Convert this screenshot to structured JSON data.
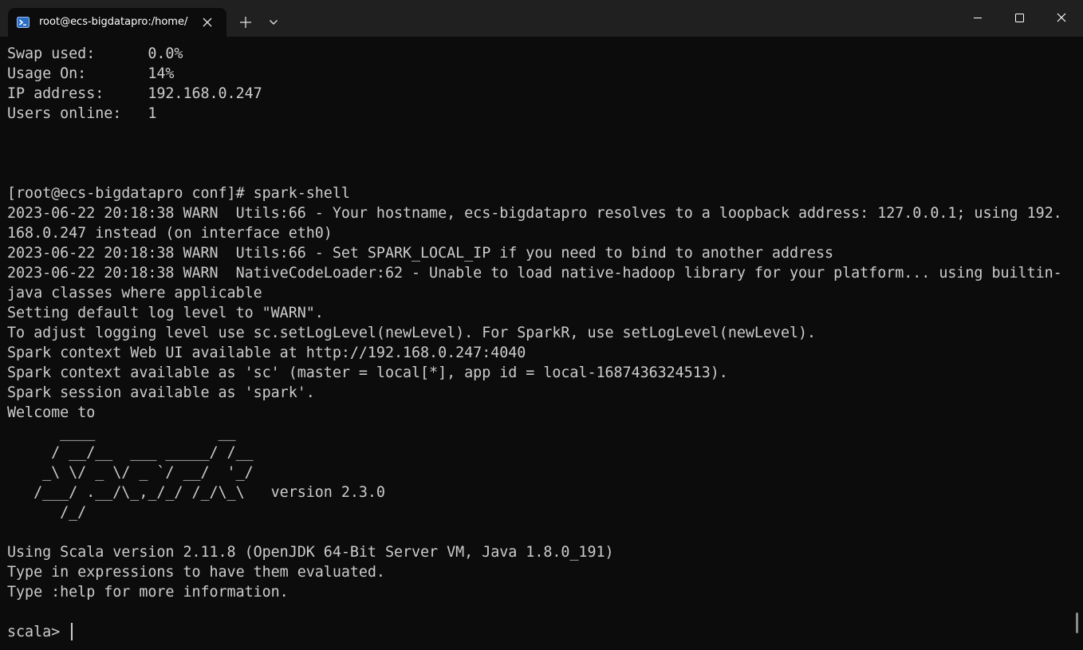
{
  "titlebar": {
    "tab_title": "root@ecs-bigdatapro:/home/",
    "tab_icon": "powershell-icon",
    "new_tab_icon": "plus-icon",
    "dropdown_icon": "chevron-down-icon",
    "minimize_icon": "minimize-icon",
    "maximize_icon": "maximize-icon",
    "close_icon": "close-icon"
  },
  "colors": {
    "titlebar_bg": "#202020",
    "terminal_bg": "#0c0c0c",
    "terminal_fg": "#cccccc",
    "tab_icon_accent": "#2b6cc4"
  },
  "terminal": {
    "lines": [
      "Swap used:      0.0%",
      "Usage On:       14%",
      "IP address:     192.168.0.247",
      "Users online:   1",
      "",
      "",
      "",
      "[root@ecs-bigdatapro conf]# spark-shell",
      "2023-06-22 20:18:38 WARN  Utils:66 - Your hostname, ecs-bigdatapro resolves to a loopback address: 127.0.0.1; using 192.",
      "168.0.247 instead (on interface eth0)",
      "2023-06-22 20:18:38 WARN  Utils:66 - Set SPARK_LOCAL_IP if you need to bind to another address",
      "2023-06-22 20:18:38 WARN  NativeCodeLoader:62 - Unable to load native-hadoop library for your platform... using builtin-",
      "java classes where applicable",
      "Setting default log level to \"WARN\".",
      "To adjust logging level use sc.setLogLevel(newLevel). For SparkR, use setLogLevel(newLevel).",
      "Spark context Web UI available at http://192.168.0.247:4040",
      "Spark context available as 'sc' (master = local[*], app id = local-1687436324513).",
      "Spark session available as 'spark'.",
      "Welcome to",
      "      ____              __",
      "     / __/__  ___ _____/ /__",
      "    _\\ \\/ _ \\/ _ `/ __/  '_/",
      "   /___/ .__/\\_,_/_/ /_/\\_\\   version 2.3.0",
      "      /_/",
      "",
      "Using Scala version 2.11.8 (OpenJDK 64-Bit Server VM, Java 1.8.0_191)",
      "Type in expressions to have them evaluated.",
      "Type :help for more information.",
      ""
    ],
    "prompt": "scala> "
  }
}
